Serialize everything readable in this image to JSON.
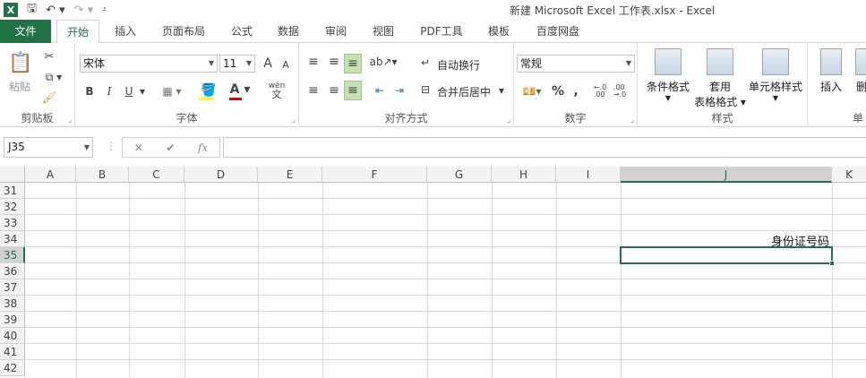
{
  "window": {
    "title": "新建 Microsoft Excel 工作表.xlsx - Excel",
    "app_icon": "X"
  },
  "tabs": [
    {
      "label": "文件"
    },
    {
      "label": "开始"
    },
    {
      "label": "插入"
    },
    {
      "label": "页面布局"
    },
    {
      "label": "公式"
    },
    {
      "label": "数据"
    },
    {
      "label": "审阅"
    },
    {
      "label": "视图"
    },
    {
      "label": "PDF工具"
    },
    {
      "label": "模板"
    },
    {
      "label": "百度网盘"
    }
  ],
  "ribbon": {
    "clipboard": {
      "label": "剪贴板",
      "paste": "粘贴"
    },
    "font": {
      "label": "字体",
      "name": "宋体",
      "size": "11",
      "bold": "B",
      "italic": "I",
      "underline": "U",
      "grow": "A",
      "shrink": "A",
      "wen": "wén"
    },
    "align": {
      "label": "对齐方式",
      "wrap": "自动换行",
      "merge": "合并后居中"
    },
    "number": {
      "label": "数字",
      "format": "常规",
      "percent": "%",
      "comma": ","
    },
    "styles": {
      "label": "样式",
      "cond": "条件格式",
      "table1": "套用",
      "table2": "表格格式",
      "cell": "单元格样式"
    },
    "cells": {
      "label": "单",
      "insert": "插入",
      "delete": "删"
    }
  },
  "formula": {
    "namebox": "J35",
    "fx": "fx",
    "cancel": "✕",
    "enter": "✔",
    "value": ""
  },
  "columns": [
    "A",
    "B",
    "C",
    "D",
    "E",
    "F",
    "G",
    "H",
    "I",
    "J",
    "K"
  ],
  "rows": [
    "31",
    "32",
    "33",
    "34",
    "35",
    "36",
    "37",
    "38",
    "39",
    "40",
    "41",
    "42"
  ],
  "cells": {
    "J34": "身份证号码"
  },
  "colors": {
    "accent": "#217346",
    "font_red": "#e00000",
    "fill_yellow": "#ffff00",
    "font_green": "#00a651"
  }
}
